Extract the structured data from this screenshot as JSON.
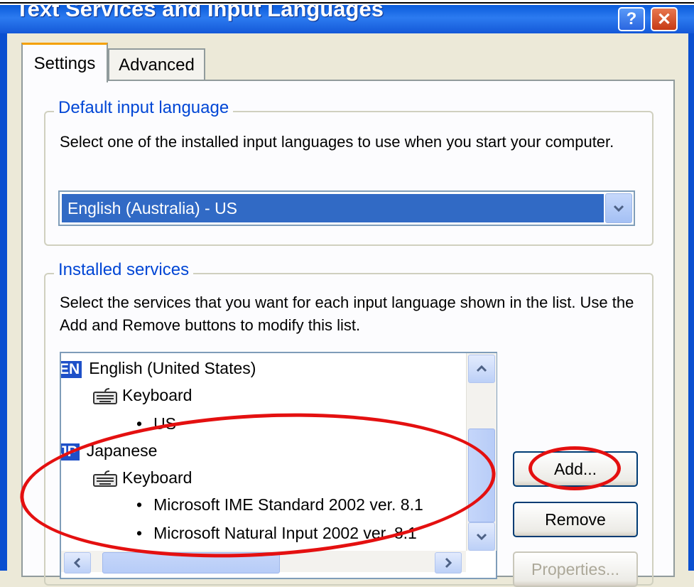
{
  "window": {
    "title": "Text Services and Input Languages",
    "help_label": "?",
    "close_label": "✕"
  },
  "tabs": [
    {
      "label": "Settings",
      "active": true
    },
    {
      "label": "Advanced",
      "active": false
    }
  ],
  "default_language": {
    "legend": "Default input language",
    "description": "Select one of the installed input languages to use when you start your computer.",
    "selected_value": "English (Australia) - US"
  },
  "installed_services": {
    "legend": "Installed services",
    "description": "Select the services that you want for each input language shown in the list. Use the Add and Remove buttons to modify this list.",
    "items": [
      {
        "type": "language",
        "badge": "EN",
        "label": "English (United States)"
      },
      {
        "type": "category",
        "label": "Keyboard"
      },
      {
        "type": "service",
        "bullet": "•",
        "label": "US"
      },
      {
        "type": "language",
        "badge": "JP",
        "label": "Japanese"
      },
      {
        "type": "category",
        "label": "Keyboard"
      },
      {
        "type": "service",
        "bullet": "•",
        "label": "Microsoft IME Standard 2002 ver. 8.1"
      },
      {
        "type": "service",
        "bullet": "•",
        "label": "Microsoft Natural Input 2002 ver. 8.1"
      }
    ],
    "scrollbar": {
      "up_icon": "chevron-up-icon",
      "down_icon": "chevron-down-icon",
      "left_icon": "chevron-left-icon",
      "right_icon": "chevron-right-icon"
    }
  },
  "buttons": {
    "add": "Add...",
    "remove": "Remove",
    "properties": "Properties..."
  },
  "colors": {
    "title_bar": "#0A5BDB",
    "selection": "#316AC5",
    "group_legend": "#0046D5",
    "annotation": "#E41010"
  }
}
